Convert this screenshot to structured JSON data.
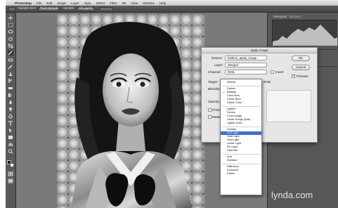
{
  "menubar": {
    "app": "Photoshop",
    "items": [
      "File",
      "Edit",
      "Image",
      "Layer",
      "Type",
      "Select",
      "Filter",
      "3D",
      "View",
      "Window",
      "Help"
    ]
  },
  "optionsbar": {
    "label1": "Sample Size:",
    "value1": "Point Sample",
    "label2": "Sample:",
    "value2": "All Layers"
  },
  "panels": {
    "tab1": "Histogram",
    "tab2": "Navigator"
  },
  "dialog": {
    "title": "Apply Image",
    "source_label": "Source:",
    "source_value": "fashion_apply_image",
    "layer_label": "Layer:",
    "layer_value": "Merged",
    "channel_label": "Channel:",
    "channel_value": "RGB",
    "invert_label": "Invert",
    "target_label": "Target:",
    "target_value": "RGB",
    "blending_label": "Blending:",
    "opacity_label": "Opacity:",
    "preserve_label": "Preserve",
    "mask_label": "Mask...",
    "ok_label": "OK",
    "cancel_label": "Cancel",
    "preview_label": "Preview"
  },
  "menu": {
    "items": [
      "Normal",
      "Darken",
      "Multiply",
      "Color Burn",
      "Linear Burn",
      "Darker Color",
      "Lighten",
      "Screen",
      "Color Dodge",
      "Linear Dodge (Add)",
      "Lighter Color",
      "Overlay",
      "Soft Light",
      "Hard Light",
      "Vivid Light",
      "Linear Light",
      "Pin Light",
      "Hard Mix",
      "Add",
      "Subtract",
      "Difference",
      "Exclusion",
      "Divide"
    ],
    "selected": "Multiply",
    "highlighted": "Soft Light"
  },
  "watermark": "lynda.com"
}
